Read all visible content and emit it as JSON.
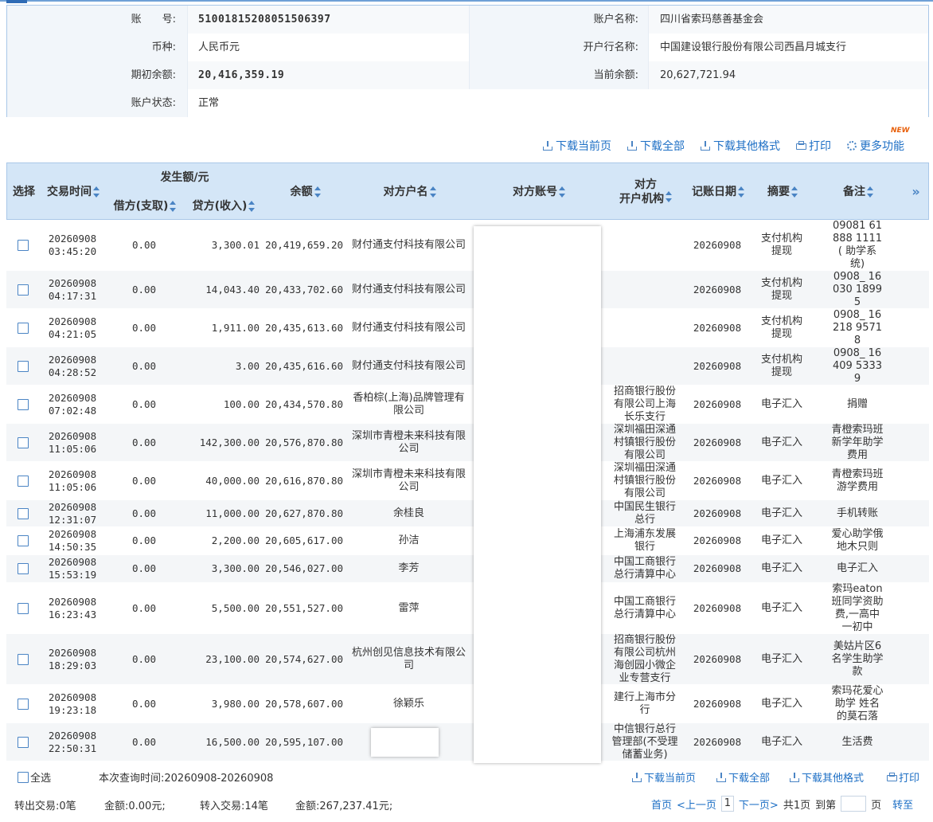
{
  "account": {
    "acct_no_label": "账　　号:",
    "acct_no": "51001815208051506397",
    "acct_name_label": "账户名称:",
    "acct_name": "四川省索玛慈善基金会",
    "currency_label": "币种:",
    "currency": "人民币元",
    "bank_label": "开户行名称:",
    "bank": "中国建设银行股份有限公司西昌月城支行",
    "opening_label": "期初余额:",
    "opening": "20,416,359.19",
    "current_label": "当前余额:",
    "current": "20,627,721.94",
    "status_label": "账户状态:",
    "status": "正常"
  },
  "toolbar": {
    "download_page": "下载当前页",
    "download_all": "下载全部",
    "download_other": "下载其他格式",
    "print": "打印",
    "more": "更多功能",
    "new_badge": "NEW"
  },
  "columns": {
    "select": "选择",
    "time": "交易时间",
    "amount_group": "发生额/元",
    "debit": "借方(支取)",
    "credit": "贷方(收入)",
    "balance": "余额",
    "party_name": "对方户名",
    "party_acct": "对方账号",
    "party_bank_1": "对方",
    "party_bank_2": "开户机构",
    "post_date": "记账日期",
    "summary": "摘要",
    "remark": "备注",
    "more": "»"
  },
  "rows": [
    {
      "date": "20260908",
      "time": "03:45:20",
      "debit": "0.00",
      "credit": "3,300.01",
      "balance": "20,419,659.20",
      "name": "财付通支付科技有限公司",
      "bank": "",
      "post": "20260908",
      "summary": "支付机构提现",
      "remark": "09081 61888 1111( 助学系统)"
    },
    {
      "date": "20260908",
      "time": "04:17:31",
      "debit": "0.00",
      "credit": "14,043.40",
      "balance": "20,433,702.60",
      "name": "财付通支付科技有限公司",
      "bank": "",
      "post": "20260908",
      "summary": "支付机构提现",
      "remark": "0908_ 16030 18995"
    },
    {
      "date": "20260908",
      "time": "04:21:05",
      "debit": "0.00",
      "credit": "1,911.00",
      "balance": "20,435,613.60",
      "name": "财付通支付科技有限公司",
      "bank": "",
      "post": "20260908",
      "summary": "支付机构提现",
      "remark": "0908_ 16218 95718"
    },
    {
      "date": "20260908",
      "time": "04:28:52",
      "debit": "0.00",
      "credit": "3.00",
      "balance": "20,435,616.60",
      "name": "财付通支付科技有限公司",
      "bank": "",
      "post": "20260908",
      "summary": "支付机构提现",
      "remark": "0908_ 16409 53339"
    },
    {
      "date": "20260908",
      "time": "07:02:48",
      "debit": "0.00",
      "credit": "100.00",
      "balance": "20,434,570.80",
      "name": "香柏棕(上海)品牌管理有限公司",
      "bank": "招商银行股份有限公司上海长乐支行",
      "post": "20260908",
      "summary": "电子汇入",
      "remark": "捐赠"
    },
    {
      "date": "20260908",
      "time": "11:05:06",
      "debit": "0.00",
      "credit": "142,300.00",
      "balance": "20,576,870.80",
      "name": "深圳市青橙未来科技有限公司",
      "bank": "深圳福田深通村镇银行股份有限公司",
      "post": "20260908",
      "summary": "电子汇入",
      "remark": "青橙索玛班新学年助学费用"
    },
    {
      "date": "20260908",
      "time": "11:05:06",
      "debit": "0.00",
      "credit": "40,000.00",
      "balance": "20,616,870.80",
      "name": "深圳市青橙未来科技有限公司",
      "bank": "深圳福田深通村镇银行股份有限公司",
      "post": "20260908",
      "summary": "电子汇入",
      "remark": "青橙索玛班游学费用"
    },
    {
      "date": "20260908",
      "time": "12:31:07",
      "debit": "0.00",
      "credit": "11,000.00",
      "balance": "20,627,870.80",
      "name": "余桂良",
      "bank": "中国民生银行总行",
      "post": "20260908",
      "summary": "电子汇入",
      "remark": "手机转账"
    },
    {
      "date": "20260908",
      "time": "14:50:35",
      "debit": "0.00",
      "credit": "2,200.00",
      "balance": "20,605,617.00",
      "name": "孙洁",
      "bank": "上海浦东发展银行",
      "post": "20260908",
      "summary": "电子汇入",
      "remark": "爱心助学俄地木只则"
    },
    {
      "date": "20260908",
      "time": "15:53:19",
      "debit": "0.00",
      "credit": "3,300.00",
      "balance": "20,546,027.00",
      "name": "李芳",
      "bank": "中国工商银行总行清算中心",
      "post": "20260908",
      "summary": "电子汇入",
      "remark": "电子汇入"
    },
    {
      "date": "20260908",
      "time": "16:23:43",
      "debit": "0.00",
      "credit": "5,500.00",
      "balance": "20,551,527.00",
      "name": "雷萍",
      "bank": "中国工商银行总行清算中心",
      "post": "20260908",
      "summary": "电子汇入",
      "remark": "索玛eaton班同学资助费,一高中一初中"
    },
    {
      "date": "20260908",
      "time": "18:29:03",
      "debit": "0.00",
      "credit": "23,100.00",
      "balance": "20,574,627.00",
      "name": "杭州创见信息技术有限公司",
      "bank": "招商银行股份有限公司杭州海创园小微企业专营支行",
      "post": "20260908",
      "summary": "电子汇入",
      "remark": "美姑片区6名学生助学款"
    },
    {
      "date": "20260908",
      "time": "19:23:18",
      "debit": "0.00",
      "credit": "3,980.00",
      "balance": "20,578,607.00",
      "name": "徐颖乐",
      "bank": "建行上海市分行",
      "post": "20260908",
      "summary": "电子汇入",
      "remark": "索玛花爱心助学 姓名的莫石落"
    },
    {
      "date": "20260908",
      "time": "22:50:31",
      "debit": "0.00",
      "credit": "16,500.00",
      "balance": "20,595,107.00",
      "name": "",
      "bank": "中信银行总行管理部(不受理储蓄业务)",
      "post": "20260908",
      "summary": "电子汇入",
      "remark": "生活费"
    }
  ],
  "footer": {
    "select_all": "全选",
    "query_time": "本次查询时间:20260908-20260908",
    "download_page": "下载当前页",
    "download_all": "下载全部",
    "download_other": "下载其他格式",
    "print": "打印",
    "out_summary": "转出交易:0笔",
    "out_amount": "金额:0.00元;",
    "in_summary": "转入交易:14笔",
    "in_amount": "金额:267,237.41元;",
    "first": "首页",
    "prev": "<上一页",
    "page": "1",
    "next": "下一页>",
    "total": "共1页",
    "goto_label": "到第",
    "page_unit": "页",
    "go": "转至"
  }
}
